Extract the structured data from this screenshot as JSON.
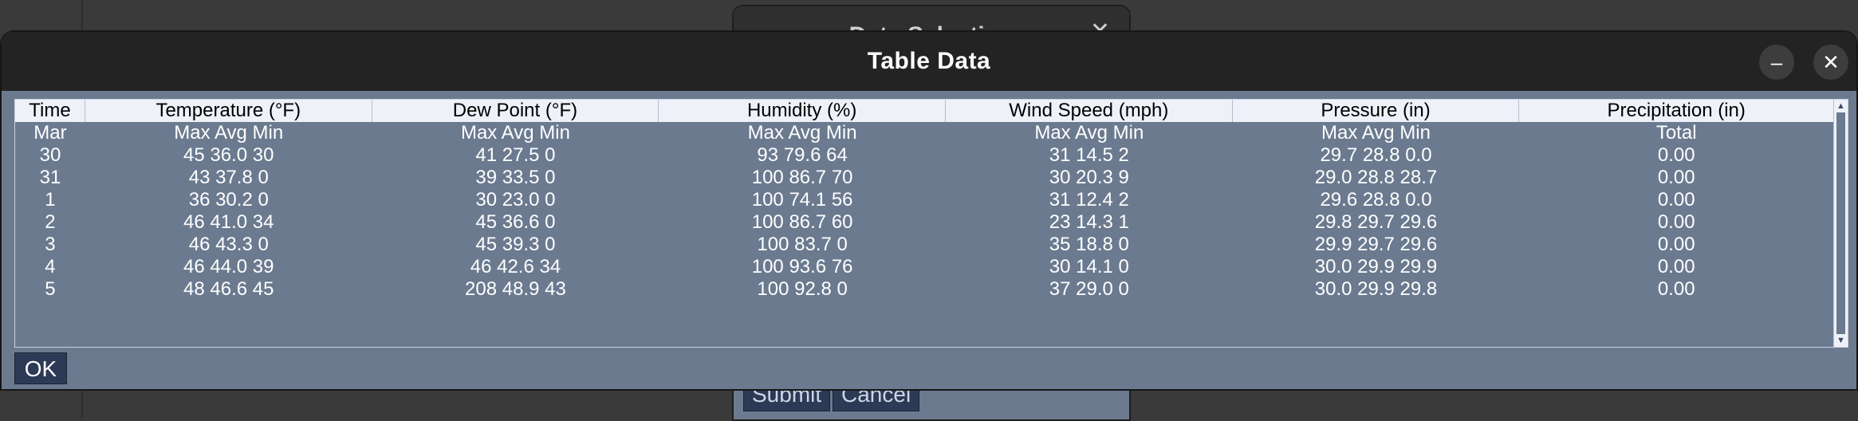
{
  "background_window": {
    "title": "Data Selection",
    "close_icon": "close-icon",
    "submit_label": "Submit",
    "cancel_label": "Cancel"
  },
  "dialog": {
    "title": "Table Data",
    "minimize_icon": "minimize-icon",
    "close_icon": "close-icon",
    "ok_label": "OK"
  },
  "colors": {
    "dialog_bg": "#6b7a8f",
    "titlebar_bg": "#232323",
    "header_bg": "#eef1f8",
    "button_bg": "#2d3a55"
  },
  "table": {
    "headers": [
      "Time",
      "Temperature (°F)",
      "Dew Point (°F)",
      "Humidity (%)",
      "Wind Speed (mph)",
      "Pressure (in)",
      "Precipitation (in)"
    ],
    "rows": [
      [
        "Mar",
        "Max Avg Min",
        "Max Avg Min",
        "Max Avg Min",
        "Max Avg Min",
        "Max Avg Min",
        "Total"
      ],
      [
        "30",
        "45 36.0 30",
        "41 27.5 0",
        "93 79.6 64",
        "31 14.5 2",
        "29.7 28.8 0.0",
        "0.00"
      ],
      [
        "31",
        "43 37.8 0",
        "39 33.5 0",
        "100 86.7 70",
        "30 20.3 9",
        "29.0 28.8 28.7",
        "0.00"
      ],
      [
        "1",
        "36 30.2 0",
        "30 23.0 0",
        "100 74.1 56",
        "31 12.4 2",
        "29.6 28.8 0.0",
        "0.00"
      ],
      [
        "2",
        "46 41.0 34",
        "45 36.6 0",
        "100 86.7 60",
        "23 14.3 1",
        "29.8 29.7 29.6",
        "0.00"
      ],
      [
        "3",
        "46 43.3 0",
        "45 39.3 0",
        "100 83.7 0",
        "35 18.8 0",
        "29.9 29.7 29.6",
        "0.00"
      ],
      [
        "4",
        "46 44.0 39",
        "46 42.6 34",
        "100 93.6 76",
        "30 14.1 0",
        "30.0 29.9 29.9",
        "0.00"
      ],
      [
        "5",
        "48 46.6 45",
        "208 48.9 43",
        "100 92.8 0",
        "37 29.0 0",
        "30.0 29.9 29.8",
        "0.00"
      ]
    ]
  }
}
